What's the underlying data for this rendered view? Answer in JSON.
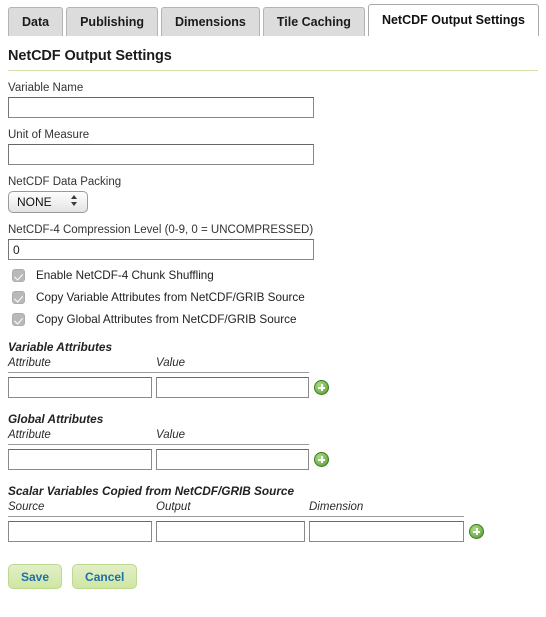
{
  "tabs": [
    {
      "label": "Data",
      "active": false
    },
    {
      "label": "Publishing",
      "active": false
    },
    {
      "label": "Dimensions",
      "active": false
    },
    {
      "label": "Tile Caching",
      "active": false
    },
    {
      "label": "NetCDF Output Settings",
      "active": true
    }
  ],
  "page": {
    "title": "NetCDF Output Settings"
  },
  "fields": {
    "variable_name": {
      "label": "Variable Name",
      "value": "",
      "placeholder": ""
    },
    "unit_of_measure": {
      "label": "Unit of Measure",
      "value": "",
      "placeholder": ""
    },
    "data_packing": {
      "label": "NetCDF Data Packing",
      "selected": "NONE",
      "options": [
        "NONE"
      ]
    },
    "compression_level": {
      "label": "NetCDF-4 Compression Level (0-9, 0 = UNCOMPRESSED)",
      "value": "0",
      "placeholder": ""
    }
  },
  "checkboxes": [
    {
      "label": "Enable NetCDF-4 Chunk Shuffling",
      "checked": true
    },
    {
      "label": "Copy Variable Attributes from NetCDF/GRIB Source",
      "checked": true
    },
    {
      "label": "Copy Global Attributes from NetCDF/GRIB Source",
      "checked": true
    }
  ],
  "variable_attributes": {
    "heading": "Variable Attributes",
    "columns": [
      "Attribute",
      "Value"
    ],
    "row": {
      "attribute": "",
      "value": ""
    },
    "add_label": "+"
  },
  "global_attributes": {
    "heading": "Global Attributes",
    "columns": [
      "Attribute",
      "Value"
    ],
    "row": {
      "attribute": "",
      "value": ""
    },
    "add_label": "+"
  },
  "scalar_variables": {
    "heading": "Scalar Variables Copied from NetCDF/GRIB Source",
    "columns": [
      "Source",
      "Output",
      "Dimension"
    ],
    "row": {
      "source": "",
      "output": "",
      "dimension": ""
    },
    "add_label": "+"
  },
  "buttons": {
    "save": "Save",
    "cancel": "Cancel"
  },
  "colors": {
    "accent_rule": "#cfe0a8",
    "button_bg": "#cfe6a2",
    "button_text": "#1f6ea8",
    "add_icon": "#7cbb56",
    "tab_inactive_bg": "#dcdcdc",
    "tab_active_bg": "#ffffff"
  }
}
